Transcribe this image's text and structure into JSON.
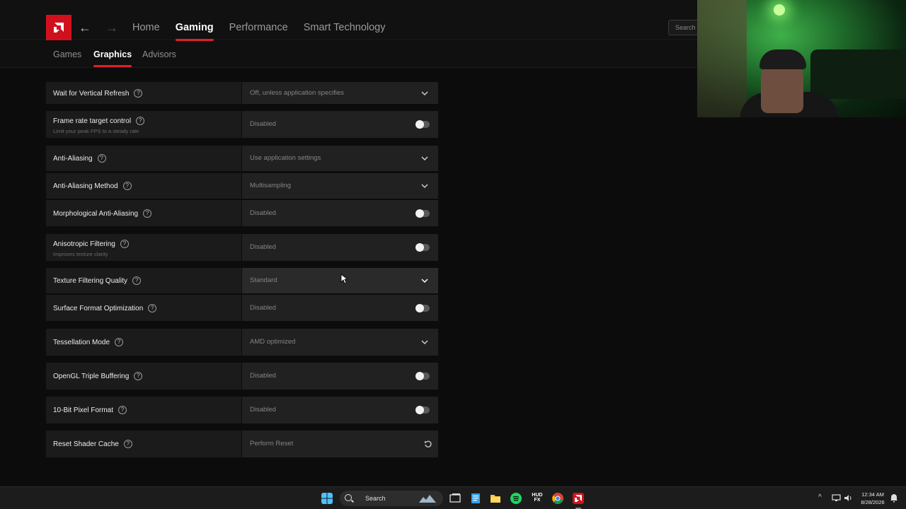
{
  "app": {
    "brand_color": "#d0111d",
    "accent_color": "#e0202a",
    "top_tabs": [
      {
        "label": "Home",
        "active": false
      },
      {
        "label": "Gaming",
        "active": true
      },
      {
        "label": "Performance",
        "active": false
      },
      {
        "label": "Smart Technology",
        "active": false
      }
    ],
    "search_placeholder": "Search",
    "sub_tabs": [
      {
        "label": "Games",
        "active": false
      },
      {
        "label": "Graphics",
        "active": true
      },
      {
        "label": "Advisors",
        "active": false
      }
    ]
  },
  "settings": [
    {
      "name": "Wait for Vertical Refresh",
      "desc": "",
      "value": "Off, unless application specifies",
      "control": "dropdown"
    },
    {
      "name": "Frame rate target control",
      "desc": "Limit your peak FPS to a steady rate",
      "value": "Disabled",
      "control": "toggle"
    },
    {
      "name": "Anti-Aliasing",
      "desc": "",
      "value": "Use application settings",
      "control": "dropdown"
    },
    {
      "name": "Anti-Aliasing Method",
      "desc": "",
      "value": "Multisampling",
      "control": "dropdown"
    },
    {
      "name": "Morphological Anti-Aliasing",
      "desc": "",
      "value": "Disabled",
      "control": "toggle"
    },
    {
      "name": "Anisotropic Filtering",
      "desc": "Improves texture clarity",
      "value": "Disabled",
      "control": "toggle"
    },
    {
      "name": "Texture Filtering Quality",
      "desc": "",
      "value": "Standard",
      "control": "dropdown"
    },
    {
      "name": "Surface Format Optimization",
      "desc": "",
      "value": "Disabled",
      "control": "toggle"
    },
    {
      "name": "Tessellation Mode",
      "desc": "",
      "value": "AMD optimized",
      "control": "dropdown"
    },
    {
      "name": "OpenGL Triple Buffering",
      "desc": "",
      "value": "Disabled",
      "control": "toggle"
    },
    {
      "name": "10-Bit Pixel Format",
      "desc": "",
      "value": "Disabled",
      "control": "toggle"
    },
    {
      "name": "Reset Shader Cache",
      "desc": "",
      "value": "Perform Reset",
      "control": "reset"
    }
  ],
  "taskbar": {
    "search_label": "Search",
    "icons": [
      "windows-start-icon",
      "search-icon",
      "task-view-icon",
      "notepad-icon",
      "file-explorer-icon",
      "spotify-icon",
      "hudfx-icon",
      "chrome-icon",
      "amd-software-icon"
    ],
    "hudfx_label": "HUD FX",
    "time": "12:34 AM",
    "date": "8/28/2026"
  }
}
